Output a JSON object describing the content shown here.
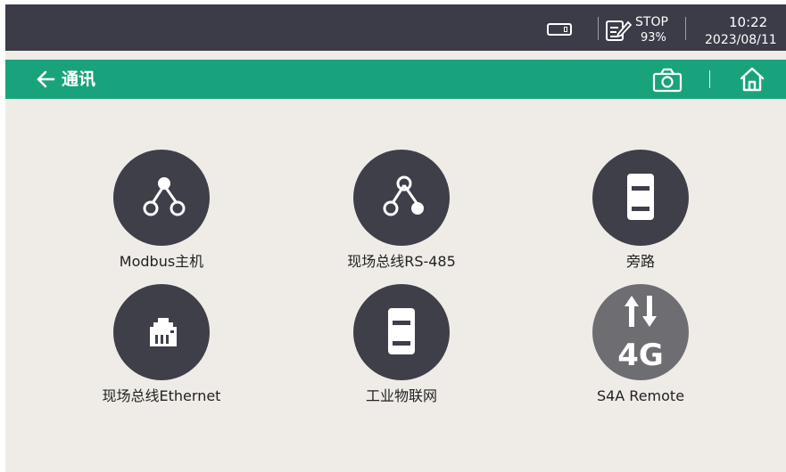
{
  "status": {
    "plc_state": "STOP",
    "battery": "93%",
    "time": "10:22",
    "date": "2023/08/11"
  },
  "header": {
    "title": "通讯",
    "back_icon": "arrow-left-icon",
    "screenshot_icon": "camera-icon",
    "home_icon": "home-icon"
  },
  "menu": {
    "items": [
      {
        "label": "Modbus主机",
        "icon": "network-nodes-icon"
      },
      {
        "label": "现场总线RS-485",
        "icon": "network-nodes-icon"
      },
      {
        "label": "旁路",
        "icon": "device-icon"
      },
      {
        "label": "现场总线Ethernet",
        "icon": "ethernet-port-icon"
      },
      {
        "label": "工业物联网",
        "icon": "device-icon"
      },
      {
        "label": "S4A Remote",
        "icon": "4g-signal-icon"
      }
    ]
  },
  "colors": {
    "status_bar": "#3b3c48",
    "title_bar": "#19a37c",
    "background": "#efece8",
    "icon_circle": "#3e3f49",
    "icon_circle_disabled": "#6d6d72"
  }
}
